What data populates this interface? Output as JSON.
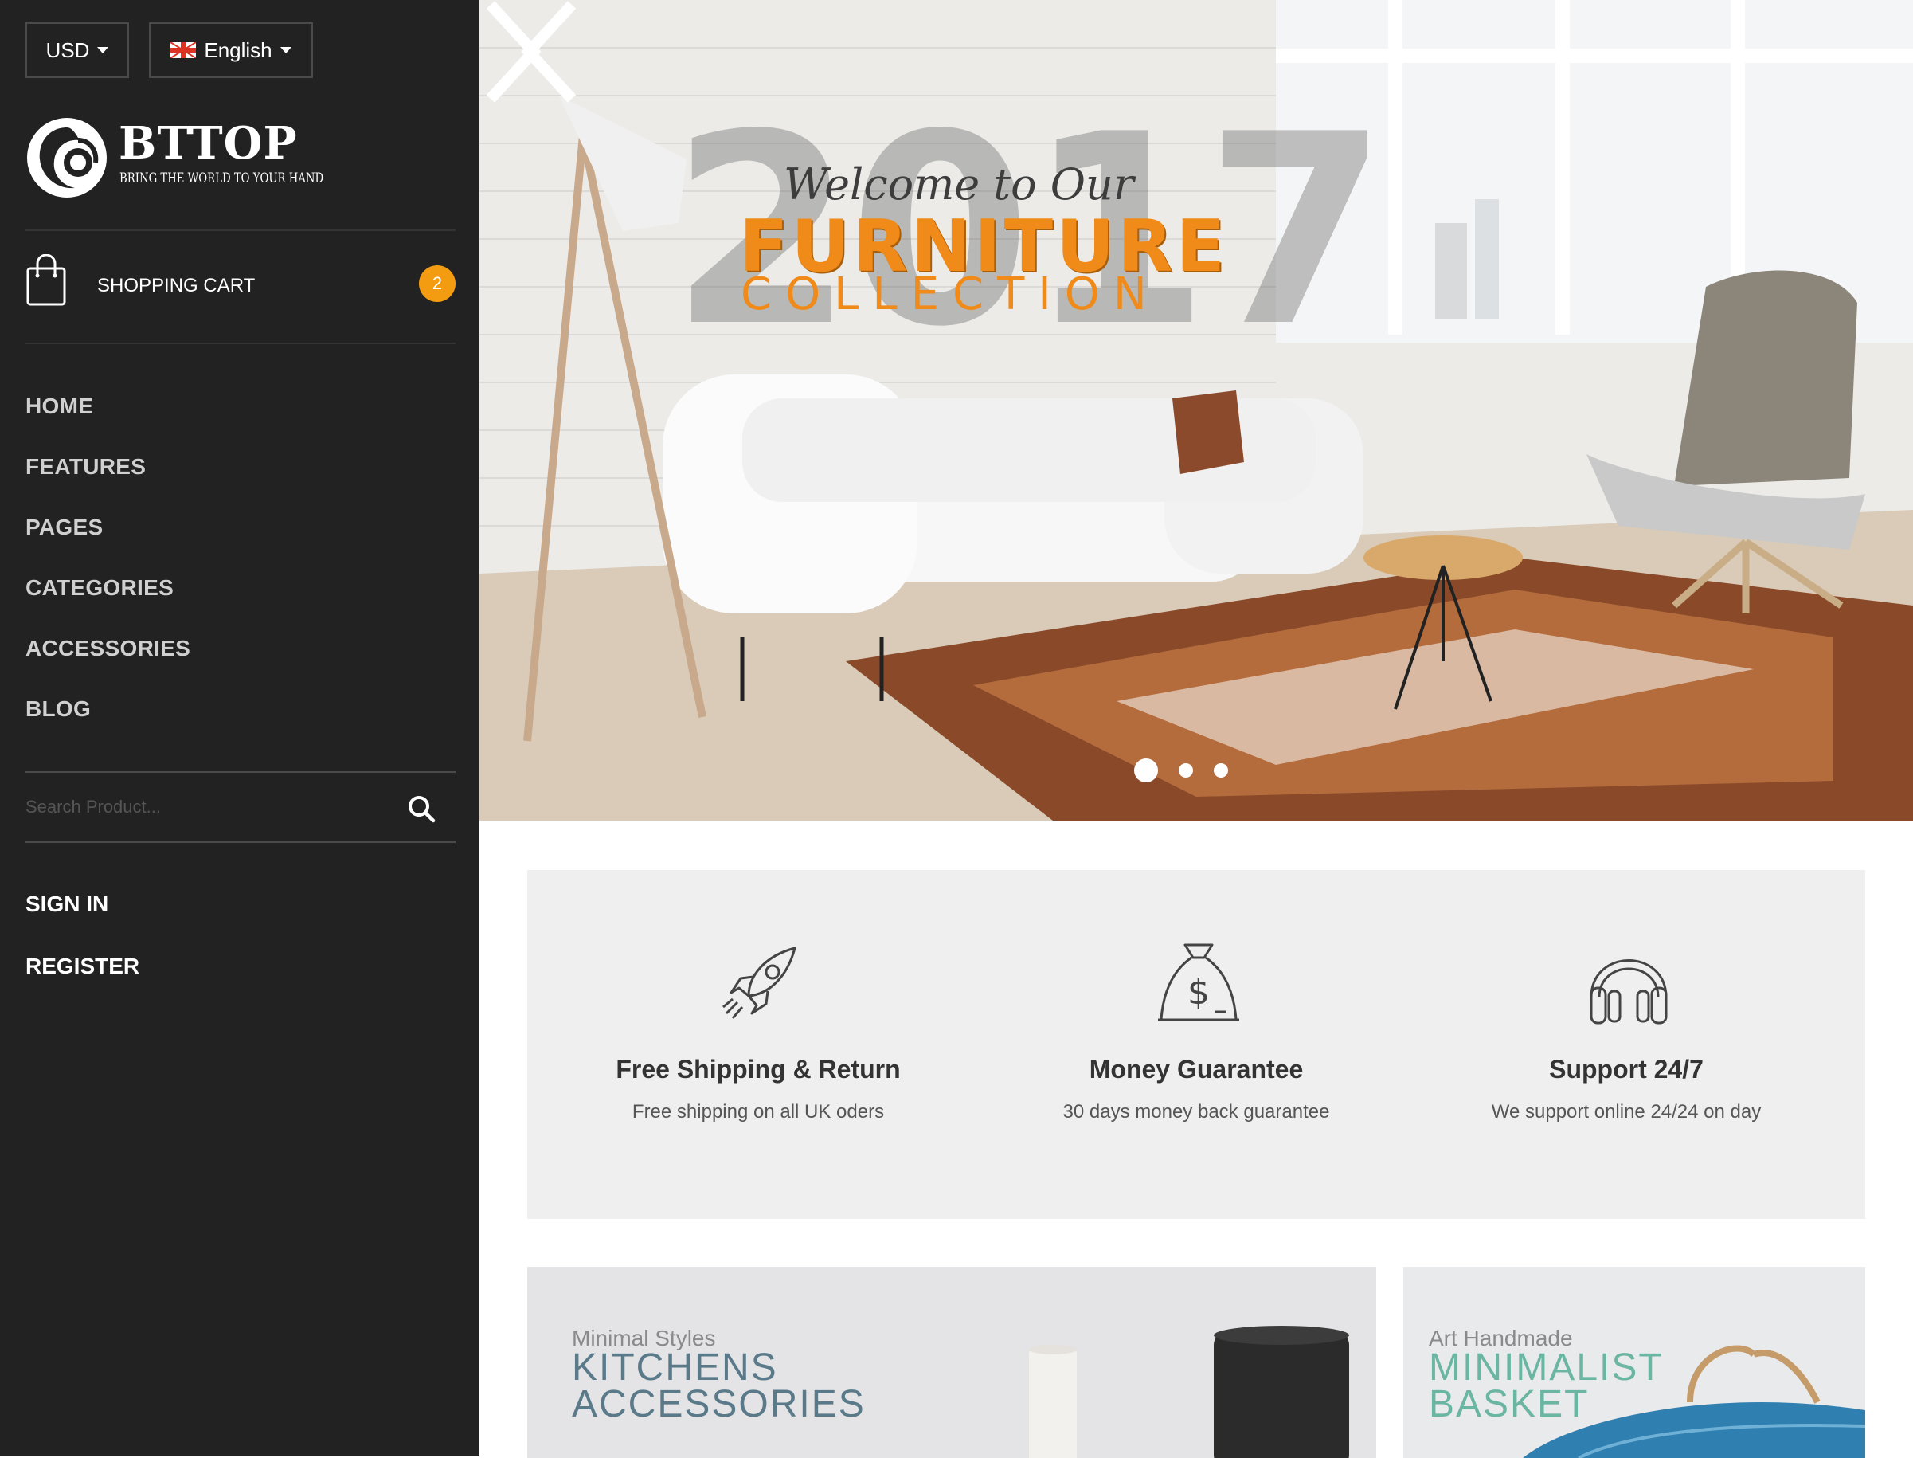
{
  "header": {
    "currency": "USD",
    "language": "English"
  },
  "brand": {
    "name": "BTTOP",
    "tagline": "BRING THE WORLD TO YOUR HAND"
  },
  "cart": {
    "label": "SHOPPING CART",
    "count": "2",
    "badge_color": "#f39c12"
  },
  "nav": {
    "items": [
      {
        "label": "HOME"
      },
      {
        "label": "FEATURES"
      },
      {
        "label": "PAGES"
      },
      {
        "label": "CATEGORIES"
      },
      {
        "label": "ACCESSORIES"
      },
      {
        "label": "BLOG"
      }
    ]
  },
  "search": {
    "placeholder": "Search Product...",
    "value": ""
  },
  "account": {
    "sign_in": "SIGN IN",
    "register": "REGISTER"
  },
  "hero": {
    "year": "2017",
    "welcome": "Welcome to Our",
    "title": "FURNITURE",
    "subtitle": "COLLECTION",
    "accent": "#f08a19",
    "slides": 3,
    "active_slide": 1
  },
  "features": [
    {
      "icon": "rocket-icon",
      "title": "Free Shipping & Return",
      "desc": "Free shipping on all UK oders"
    },
    {
      "icon": "money-bag-icon",
      "title": "Money Guarantee",
      "desc": "30 days money back guarantee"
    },
    {
      "icon": "headphones-icon",
      "title": "Support 24/7",
      "desc": "We support online 24/24 on day"
    }
  ],
  "promos": [
    {
      "sub": "Minimal Styles",
      "line1": "KITCHENS",
      "line2": "ACCESSORIES"
    },
    {
      "sub": "Art Handmade",
      "line1": "MINIMALIST",
      "line2": "BASKET"
    }
  ],
  "colors": {
    "sidebar_bg": "#222222",
    "features_bg": "#efefef"
  }
}
